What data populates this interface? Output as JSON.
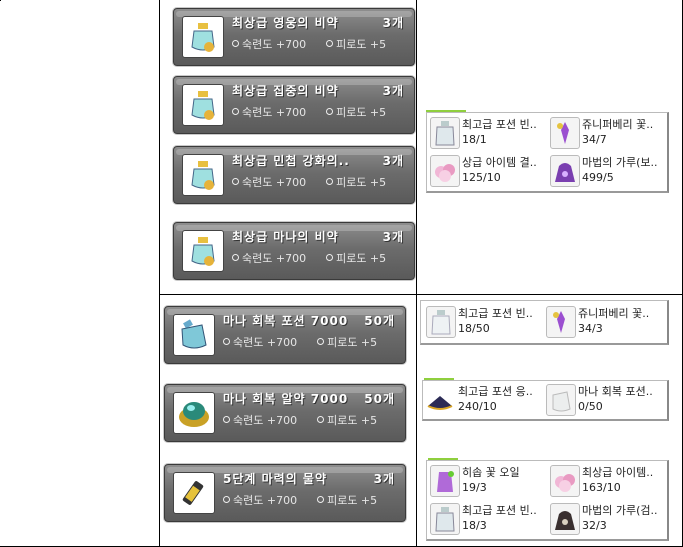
{
  "recipes_top": [
    {
      "name": "최상급 영웅의 비약",
      "qty": "3개",
      "stat1": "숙련도 +700",
      "stat2": "피로도 +5",
      "icon": "elixir-bottle-icon"
    },
    {
      "name": "최상급 집중의 비약",
      "qty": "3개",
      "stat1": "숙련도 +700",
      "stat2": "피로도 +5",
      "icon": "elixir-bottle-icon"
    },
    {
      "name": "최상급 민첩 강화의..",
      "qty": "3개",
      "stat1": "숙련도 +700",
      "stat2": "피로도 +5",
      "icon": "elixir-bottle-icon"
    },
    {
      "name": "최상급 마나의 비약",
      "qty": "3개",
      "stat1": "숙련도 +700",
      "stat2": "피로도 +5",
      "icon": "elixir-bottle-icon"
    }
  ],
  "recipes_bottom": [
    {
      "name": "마나 회복 포션 7000",
      "qty": "50개",
      "stat1": "숙련도 +700",
      "stat2": "피로도 +5",
      "icon": "mana-potion-icon"
    },
    {
      "name": "마나 회복 알약 7000",
      "qty": "50개",
      "stat1": "숙련도 +700",
      "stat2": "피로도 +5",
      "icon": "mana-pill-icon"
    },
    {
      "name": "5단계 마력의 물약",
      "qty": "3개",
      "stat1": "숙련도 +700",
      "stat2": "피로도 +5",
      "icon": "magic-vial-icon"
    }
  ],
  "ingredients_1": [
    {
      "name": "최고급 포션 빈..",
      "count": "18/1",
      "icon": "empty-potion-bottle-icon"
    },
    {
      "name": "쥬니퍼베리 꽃..",
      "count": "34/7",
      "icon": "juniper-flower-icon"
    },
    {
      "name": "상급 아이템 결..",
      "count": "125/10",
      "icon": "item-crystal-icon"
    },
    {
      "name": "마법의 가루(보..",
      "count": "499/5",
      "icon": "magic-powder-bag-icon"
    }
  ],
  "ingredients_2": [
    {
      "name": "최고급 포션 빈..",
      "count": "18/50",
      "icon": "empty-potion-bottle-icon"
    },
    {
      "name": "쥬니퍼베리 꽃..",
      "count": "34/3",
      "icon": "juniper-flower-icon"
    }
  ],
  "ingredients_3": [
    {
      "name": "최고급 포션 응..",
      "count": "240/10",
      "icon": "potion-concentrate-icon"
    },
    {
      "name": "마나 회복 포션..",
      "count": "0/50",
      "icon": "mana-potion-icon"
    }
  ],
  "ingredients_4": [
    {
      "name": "히솝 꽃 오일",
      "count": "19/3",
      "icon": "hyssop-oil-icon"
    },
    {
      "name": "최상급 아이템..",
      "count": "163/10",
      "icon": "item-crystal-icon"
    },
    {
      "name": "최고급 포션 빈..",
      "count": "18/3",
      "icon": "empty-potion-bottle-icon"
    },
    {
      "name": "마법의 가루(검..",
      "count": "32/3",
      "icon": "magic-powder-bag-icon"
    }
  ]
}
